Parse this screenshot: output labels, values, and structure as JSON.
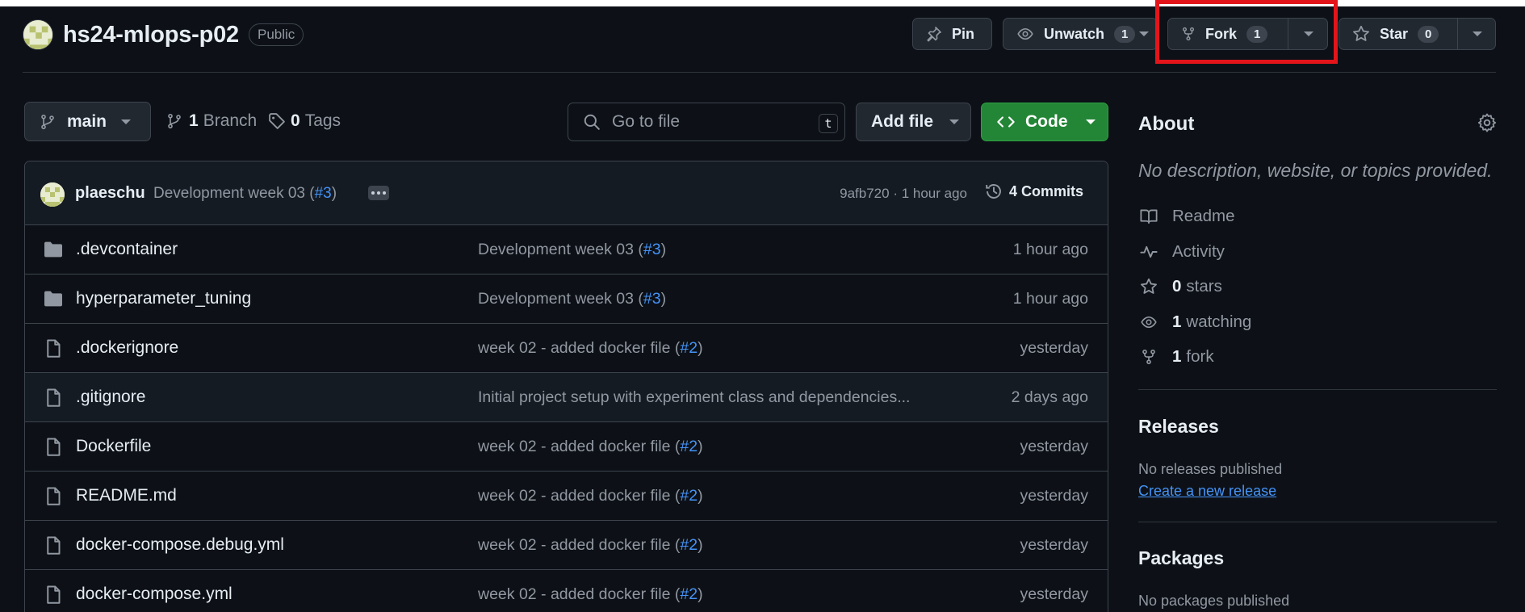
{
  "repo": {
    "name": "hs24-mlops-p02",
    "visibility": "Public"
  },
  "header_buttons": {
    "pin_label": "Pin",
    "unwatch_label": "Unwatch",
    "unwatch_count": "1",
    "fork_label": "Fork",
    "fork_count": "1",
    "star_label": "Star",
    "star_count": "0"
  },
  "toolbar": {
    "branch": "main",
    "branches_count": "1",
    "branches_label": "Branch",
    "tags_count": "0",
    "tags_label": "Tags",
    "search_placeholder": "Go to file",
    "search_shortcut": "t",
    "add_file_label": "Add file",
    "code_label": "Code"
  },
  "latest_commit": {
    "author": "plaeschu",
    "message": "Development week 03 (",
    "pr_ref": "#3",
    "message_end": ")",
    "hash_time": "9afb720 · 1 hour ago",
    "commits_count": "4",
    "commits_label": "Commits"
  },
  "files": [
    {
      "name": ".devcontainer",
      "type": "folder",
      "msg": "Development week 03 (",
      "pr": "#3",
      "msg_end": ")",
      "date": "1 hour ago"
    },
    {
      "name": "hyperparameter_tuning",
      "type": "folder",
      "msg": "Development week 03 (",
      "pr": "#3",
      "msg_end": ")",
      "date": "1 hour ago"
    },
    {
      "name": ".dockerignore",
      "type": "file",
      "msg": "week 02 - added docker file (",
      "pr": "#2",
      "msg_end": ")",
      "date": "yesterday"
    },
    {
      "name": ".gitignore",
      "type": "file",
      "msg": "Initial project setup with experiment class and dependencies...",
      "pr": "",
      "msg_end": "",
      "date": "2 days ago"
    },
    {
      "name": "Dockerfile",
      "type": "file",
      "msg": "week 02 - added docker file (",
      "pr": "#2",
      "msg_end": ")",
      "date": "yesterday"
    },
    {
      "name": "README.md",
      "type": "file",
      "msg": "week 02 - added docker file (",
      "pr": "#2",
      "msg_end": ")",
      "date": "yesterday"
    },
    {
      "name": "docker-compose.debug.yml",
      "type": "file",
      "msg": "week 02 - added docker file (",
      "pr": "#2",
      "msg_end": ")",
      "date": "yesterday"
    },
    {
      "name": "docker-compose.yml",
      "type": "file",
      "msg": "week 02 - added docker file (",
      "pr": "#2",
      "msg_end": ")",
      "date": "yesterday"
    }
  ],
  "about": {
    "title": "About",
    "description": "No description, website, or topics provided.",
    "readme_label": "Readme",
    "activity_label": "Activity",
    "stars_count": "0",
    "stars_label": "stars",
    "watching_count": "1",
    "watching_label": "watching",
    "forks_count": "1",
    "forks_label": "fork"
  },
  "releases": {
    "title": "Releases",
    "none_text": "No releases published",
    "create_link": "Create a new release"
  },
  "packages": {
    "title": "Packages",
    "none_text": "No packages published"
  },
  "colors": {
    "background": "#0d1117",
    "accent_link": "#4493f8",
    "code_button": "#238636",
    "highlight_box": "#e3151b"
  }
}
